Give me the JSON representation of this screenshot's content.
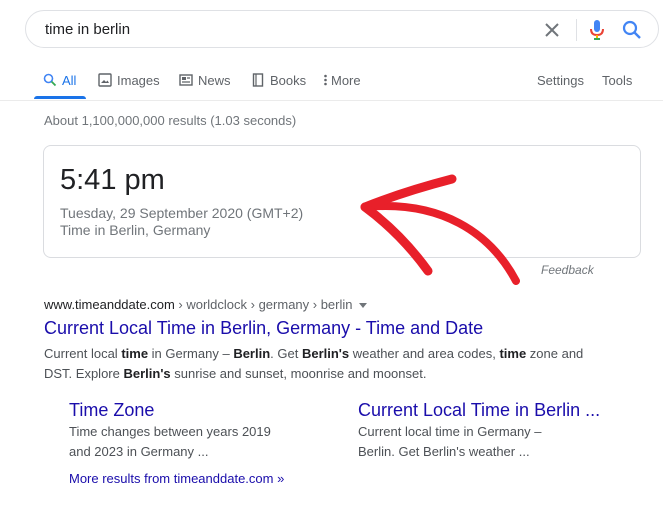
{
  "search": {
    "query": "time in berlin"
  },
  "tabs": {
    "all": "All",
    "images": "Images",
    "news": "News",
    "books": "Books",
    "more": "More",
    "settings": "Settings",
    "tools": "Tools"
  },
  "results_count": "About 1,100,000,000 results (1.03 seconds)",
  "clock": {
    "time": "5:41 pm",
    "date": "Tuesday, 29 September 2020 (GMT+2)",
    "location": "Time in Berlin, Germany",
    "feedback": "Feedback"
  },
  "result": {
    "domain": "www.timeanddate.com",
    "breadcrumb": " › worldclock › germany › berlin",
    "title": "Current Local Time in Berlin, Germany - Time and Date",
    "snippet": {
      "p1": "Current local ",
      "b1": "time",
      "p2": " in Germany – ",
      "b2": "Berlin",
      "p3": ". Get ",
      "b3": "Berlin's",
      "p4": " weather and area codes, ",
      "b4": "time",
      "p5": " zone and DST. Explore ",
      "b5": "Berlin's",
      "p6": " sunrise and sunset, moonrise and moonset."
    }
  },
  "sitelinks": [
    {
      "title": "Time Zone",
      "line1": "Time changes between years 2019",
      "line2": "and 2023 in Germany ..."
    },
    {
      "title": "Current Local Time in Berlin ...",
      "line1": "Current local time in Germany –",
      "line2": "Berlin. Get Berlin's weather ..."
    }
  ],
  "more_results": "More results from timeanddate.com »",
  "colors": {
    "link": "#1a0dab",
    "accent": "#1a73e8",
    "annotation_arrow": "#e8202a"
  },
  "icons": {
    "clear": "close-icon",
    "mic": "microphone-icon",
    "search": "search-icon",
    "all_tab": "search-icon",
    "images_tab": "image-icon",
    "news_tab": "newspaper-icon",
    "books_tab": "book-icon",
    "more_tab": "vertical-dots-icon"
  }
}
